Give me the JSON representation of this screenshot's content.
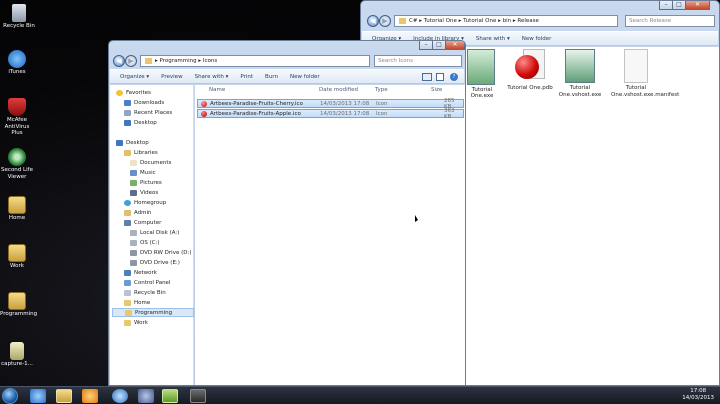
{
  "desktop": {
    "icons": [
      {
        "label": "Recycle Bin"
      },
      {
        "label": "iTunes"
      },
      {
        "label": "McAfee AntiVirus Plus"
      },
      {
        "label": "Second Life Viewer"
      },
      {
        "label": "Home"
      },
      {
        "label": "Work"
      },
      {
        "label": "Programming"
      },
      {
        "label": "capture-1..."
      }
    ]
  },
  "back_window": {
    "breadcrumb": [
      "C#",
      "Tutorial One",
      "Tutorial One",
      "bin",
      "Release"
    ],
    "search_placeholder": "Search Release",
    "commands": [
      "Organize ▾",
      "Include in library ▾",
      "Share with ▾",
      "New folder"
    ],
    "files": [
      {
        "name": "Tutorial One.exe"
      },
      {
        "name": "Tutorial One.pdb"
      },
      {
        "name": "Tutorial One.vshost.exe"
      },
      {
        "name": "Tutorial One.vshost.exe.manifest"
      }
    ]
  },
  "front_window": {
    "breadcrumb": [
      "Programming",
      "Icons"
    ],
    "search_placeholder": "Search Icons",
    "commands": [
      "Organize ▾",
      "Preview",
      "Share with ▾",
      "Print",
      "Burn",
      "New folder"
    ],
    "nav": {
      "favorites_header": "Favorites",
      "favorites": [
        "Downloads",
        "Recent Places",
        "Desktop"
      ],
      "tree": [
        "Desktop",
        "Libraries",
        "Documents",
        "Music",
        "Pictures",
        "Videos",
        "Homegroup",
        "Admin",
        "Computer",
        "Local Disk (A:)",
        "OS (C:)",
        "DVD RW Drive (D:)",
        "DVD Drive (E:)",
        "Network",
        "Control Panel",
        "Recycle Bin",
        "Home",
        "Programming",
        "Work"
      ]
    },
    "columns": [
      "Name",
      "Date modified",
      "Type",
      "Size"
    ],
    "files": [
      {
        "name": "Artbees-Paradise-Fruits-Cherry.ico",
        "date": "14/03/2013 17:08",
        "type": "Icon",
        "size": "285 KB"
      },
      {
        "name": "Artbees-Paradise-Fruits-Apple.ico",
        "date": "14/03/2013 17:08",
        "type": "Icon",
        "size": "363 KB"
      }
    ]
  },
  "taskbar": {
    "time": "17:08",
    "date": "14/03/2013"
  },
  "colors": {
    "selection": "#cce4fc",
    "frame": "#c3d5ec"
  }
}
